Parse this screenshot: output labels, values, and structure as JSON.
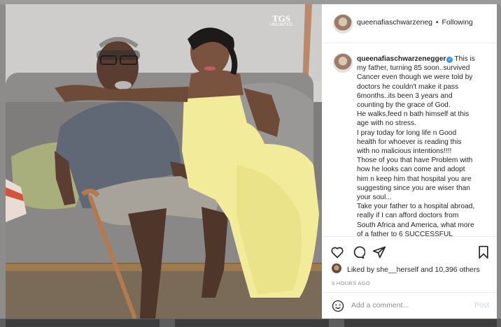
{
  "post": {
    "username": "queenafiaschwarzenegger",
    "username_truncated": "queenafiaschwarzeneg",
    "separator": "•",
    "follow_status": "Following",
    "watermark": {
      "logo": "TGS",
      "text": "UNLIMITED"
    },
    "caption_lines": [
      "This is",
      "my father, turning 85 soon..survived",
      "Cancer even though we were told by",
      "doctors he couldn't make it pass",
      "6months..its been 3 years and",
      "counting by the grace of God.",
      "He walks,feed n bath himself at this",
      "age with no stress.",
      "I pray today for long life n Good",
      "health for whoever is reading this",
      "with no malicious intentions!!!!",
      "Those of you that have Problem with",
      "how he looks can come and adopt",
      "him n keep him that hospital you are",
      "suggesting since you are wiser than",
      "your soul...",
      "Take your father to a hospital abroad,",
      "really if I can afford doctors from",
      "South Africa and America, what more",
      "of a father to 6 SUCCESSFUL"
    ],
    "likes_prefix": "Liked by",
    "likes_user": "she__herself",
    "likes_joiner": "and",
    "likes_count": "10,396 others",
    "timestamp": "3 HOURS AGO",
    "comment_placeholder": "Add a comment...",
    "post_label": "Post"
  },
  "icons": {
    "like": "heart-icon",
    "comment": "comment-icon",
    "share": "paper-plane-icon",
    "save": "bookmark-icon",
    "emoji": "smiley-icon",
    "verified": "verified-badge-icon"
  },
  "colors": {
    "link_blue": "#3897f0",
    "post_disabled": "#b2dffc",
    "text": "#262626",
    "muted": "#8e8e8e"
  }
}
